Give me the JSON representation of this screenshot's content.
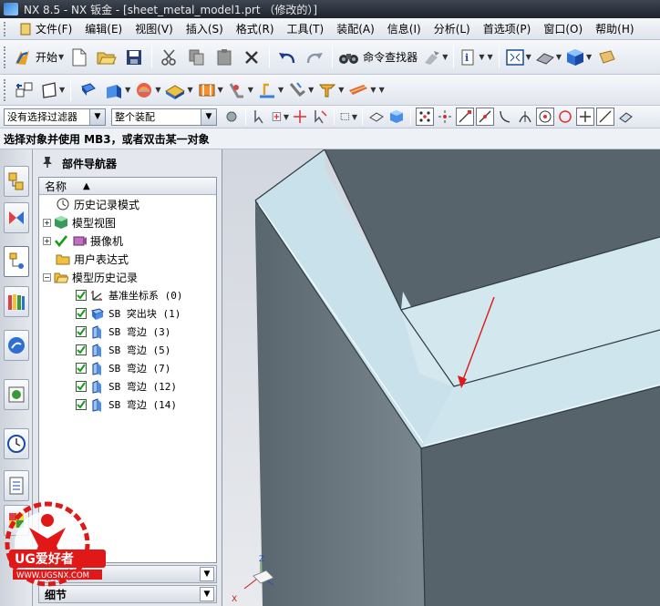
{
  "window": {
    "title": "NX 8.5 - NX 钣金 - [sheet_metal_model1.prt （修改的）]"
  },
  "menu": [
    "文件(F)",
    "编辑(E)",
    "视图(V)",
    "插入(S)",
    "格式(R)",
    "工具(T)",
    "装配(A)",
    "信息(I)",
    "分析(L)",
    "首选项(P)",
    "窗口(O)",
    "帮助(H)"
  ],
  "toolbar": {
    "start_label": "开始",
    "command_finder_label": "命令查找器"
  },
  "selection_bar": {
    "filter_value": "没有选择过滤器",
    "scope_value": "整个装配"
  },
  "status": {
    "prompt": "选择对象并使用 MB3，或者双击某一对象"
  },
  "navigator": {
    "title": "部件导航器",
    "column_name": "名称",
    "rows": [
      {
        "label": "历史记录模式"
      },
      {
        "label": "模型视图"
      },
      {
        "label": "摄像机"
      },
      {
        "label": "用户表达式"
      },
      {
        "label": "模型历史记录"
      },
      {
        "label": "基准坐标系 (0)"
      },
      {
        "label": "SB 突出块 (1)"
      },
      {
        "label": "SB 弯边 (3)"
      },
      {
        "label": "SB 弯边 (5)"
      },
      {
        "label": "SB 弯边 (7)"
      },
      {
        "label": "SB 弯边 (12)"
      },
      {
        "label": "SB 弯边 (14)"
      }
    ],
    "sections": [
      "相依性",
      "细节"
    ]
  },
  "triad": {
    "z": "Z",
    "x": "X"
  },
  "watermark": {
    "brand": "UG爱好者",
    "url": "WWW.UGSNX.COM"
  },
  "colors": {
    "accent_red": "#e01818",
    "model_top": "#cfe4ec",
    "model_side": "#5f6d74"
  }
}
